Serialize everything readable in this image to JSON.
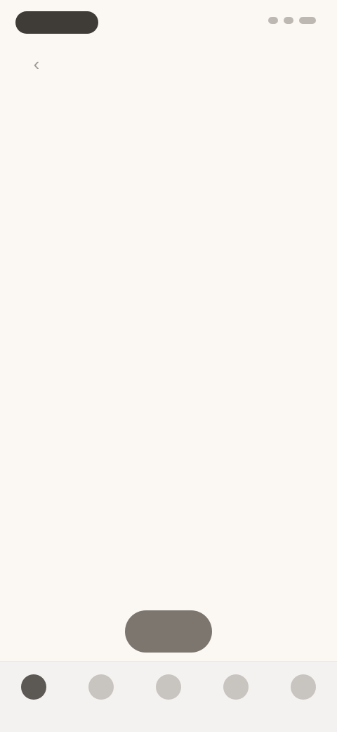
{
  "header": {
    "title": ""
  },
  "sections": [
    {
      "title": "",
      "items": [
        {
          "title": "",
          "desc1": "",
          "desc2": ""
        }
      ]
    },
    {
      "title": "",
      "items": [
        {
          "title": "",
          "desc1": ""
        },
        {
          "title": "",
          "desc1": ""
        }
      ]
    },
    {
      "title": "",
      "items": [
        {
          "title": "",
          "desc1": "",
          "desc2": ""
        },
        {
          "title": "",
          "desc1": "",
          "desc2": ""
        }
      ]
    },
    {
      "title": "",
      "items": [
        {
          "title": "",
          "desc1": ""
        }
      ]
    }
  ],
  "fab": {
    "label": ""
  },
  "nav": [
    {
      "label": ""
    },
    {
      "label": ""
    },
    {
      "label": ""
    },
    {
      "label": ""
    },
    {
      "label": ""
    }
  ],
  "icons": {
    "back": "chevron-left-icon",
    "status": [
      "signal-icon",
      "wifi-icon",
      "battery-icon"
    ]
  }
}
